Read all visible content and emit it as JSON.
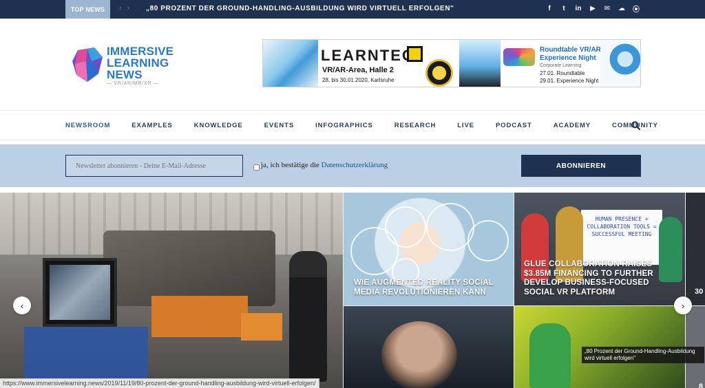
{
  "topbar": {
    "label": "TOP NEWS",
    "prev": "‹",
    "next": "›",
    "ticker": "„80 PROZENT DER GROUND-HANDLING-AUSBILDUNG WIRD VIRTUELL ERFOLGEN\"",
    "social": [
      "f",
      "t",
      "in",
      "▶",
      "✉",
      "☁",
      "⦿"
    ],
    "social_icons": [
      "facebook-icon",
      "twitter-icon",
      "linkedin-icon",
      "youtube-icon",
      "mail-icon",
      "soundcloud-icon",
      "rss-icon"
    ]
  },
  "logo": {
    "line1": "IMMERSIVE",
    "line2": "LEARNING",
    "line3": "NEWS",
    "sub": "— VR/AR/MR/XR —"
  },
  "banner": {
    "brand": "LEARNTEC",
    "sub1": "VR/AR-Area, Halle 2",
    "sub2": "28. bis 30.01.2020, Karlsruhe",
    "rt_title": "Roundtable VR/AR Experience Night",
    "rt_sub": "Corporate Learning",
    "rt_d1": "27.01. Roundtable",
    "rt_d2": "29.01. Experience Night"
  },
  "nav": {
    "items": [
      "NEWSROOM",
      "EXAMPLES",
      "KNOWLEDGE",
      "EVENTS",
      "INFOGRAPHICS",
      "RESEARCH",
      "LIVE",
      "PODCAST",
      "ACADEMY",
      "COMMUNITY"
    ]
  },
  "newsletter": {
    "placeholder": "Newsletter abonnieren - Deine E-Mail-Adresse",
    "consent_prefix": "ja, ich bestätige die ",
    "consent_link": "Datenschutzerklärung",
    "button": "ABONNIEREN"
  },
  "tiles": {
    "ar_title": "WIE AUGMENTED REALITY SOCIAL MEDIA REVOLUTIONIEREN KANN",
    "clue_title": "GLUE COLLABORATION RAISES $3.85M FINANCING TO FURTHER DEVELOP BUSINESS-FOCUSED SOCIAL VR PLATFORM",
    "clue_board": "HUMAN PRESENCE + COLLABORATION TOOLS = SUCCESSFUL MEETING",
    "edge_text": "30",
    "edge_text2": "8"
  },
  "slider": {
    "prev": "‹",
    "next": "›"
  },
  "tooltip": "„80 Prozent der Ground-Handling-Ausbildung wird virtuell erfolgen\"",
  "statusbar": "https://www.immersivelearning.news/2019/11/19/80-prozent-der-ground-handling-ausbildung-wird-virtuell-erfolgen/",
  "colors": {
    "navy": "#1f3150",
    "newsletter_bg": "#bcd0e5",
    "logo_blue": "#2a78c8"
  }
}
